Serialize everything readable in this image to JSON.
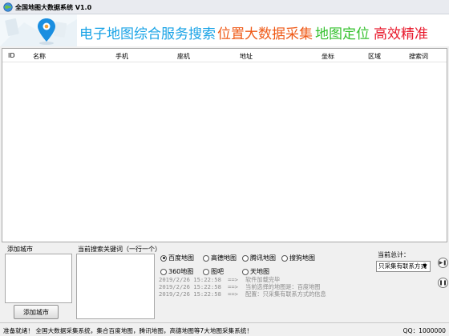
{
  "window": {
    "title": "全国地图大数据系统 V1.0"
  },
  "banner": {
    "slogans": [
      "电子地图综合服务搜索",
      "位置大数据采集",
      "地图定位",
      "高效精准"
    ],
    "colors": [
      "#19a3e6",
      "#ef5a17",
      "#34c12d",
      "#e8192c"
    ]
  },
  "table": {
    "columns": [
      "ID",
      "名称",
      "手机",
      "座机",
      "地址",
      "坐标",
      "区域",
      "搜索词"
    ],
    "rows": []
  },
  "controls": {
    "city_label": "添加城市",
    "add_city_button": "添加城市",
    "keyword_label": "当前搜索关键词（一行一个）",
    "map_sources": [
      "百度地图",
      "高德地图",
      "腾讯地图",
      "搜狗地图",
      "360地图",
      "图吧",
      "天地图"
    ],
    "selected_source": "百度地图",
    "stat_label": "当前总计：",
    "collect_mode": "只采集有联系方式"
  },
  "log": [
    {
      "time": "2019/2/26 15:22:58",
      "arrow": "==>",
      "msg": "软件加载完毕"
    },
    {
      "time": "2019/2/26 15:22:58",
      "arrow": "==>",
      "msg": "当前选择的地图是：百度地图"
    },
    {
      "time": "2019/2/26 15:22:58",
      "arrow": "==>",
      "msg": "配置：只采集有联系方式的信息"
    }
  ],
  "status": {
    "left": "准备就绪！ 全国大数据采集系统，集合百度地图，腾讯地图，高德地图等7大地图采集系统！",
    "right": "QQ：1000000"
  }
}
